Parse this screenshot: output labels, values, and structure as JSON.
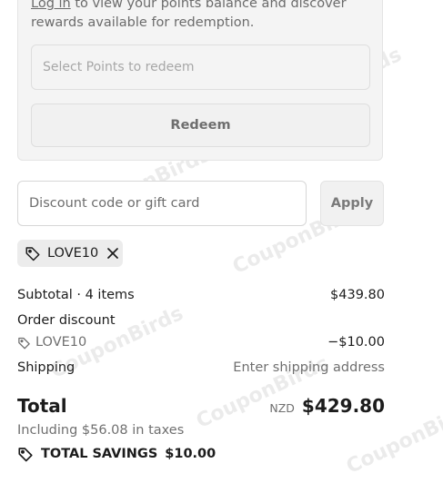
{
  "rewards": {
    "login_link": "Log in",
    "description": " to view your points balance and discover rewards available for redemption.",
    "points_placeholder": "Select Points to redeem",
    "redeem_label": "Redeem"
  },
  "discount": {
    "placeholder": "Discount code or gift card",
    "apply_label": "Apply",
    "applied_code": "LOVE10"
  },
  "summary": {
    "subtotal_label": "Subtotal · 4 items",
    "subtotal_value": "$439.80",
    "order_discount_label": "Order discount",
    "discount_code": "LOVE10",
    "discount_value": "−$10.00",
    "shipping_label": "Shipping",
    "shipping_value": "Enter shipping address",
    "total_label": "Total",
    "currency": "NZD",
    "total_value": "$429.80",
    "taxes_note": "Including $56.08 in taxes",
    "savings_label": "TOTAL SAVINGS",
    "savings_value": "$10.00"
  },
  "watermark": "CouponBirds",
  "icons": {
    "tag": "tag-icon",
    "close": "close-icon",
    "savings": "savings-tag-icon"
  }
}
